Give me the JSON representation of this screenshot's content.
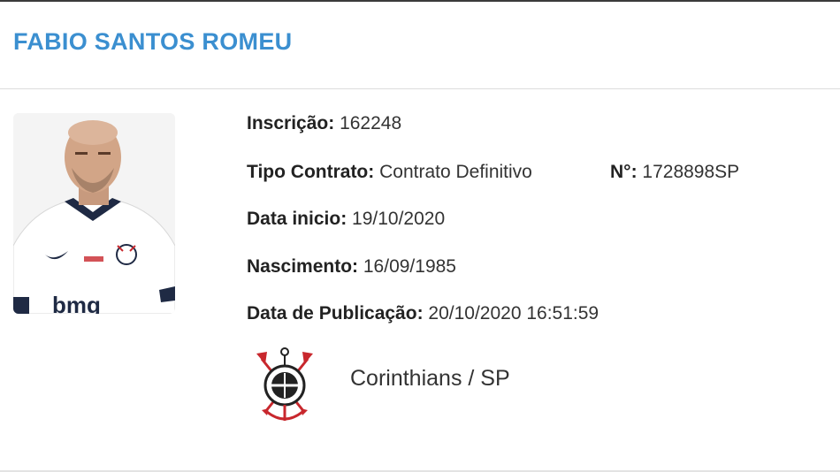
{
  "player": {
    "name": "FABIO SANTOS ROMEU"
  },
  "details": {
    "inscricao": {
      "label": "Inscrição:",
      "value": "162248"
    },
    "tipo_contrato": {
      "label": "Tipo Contrato:",
      "value": "Contrato Definitivo"
    },
    "numero": {
      "label": "N°:",
      "value": "1728898SP"
    },
    "data_inicio": {
      "label": "Data inicio:",
      "value": "19/10/2020"
    },
    "nascimento": {
      "label": "Nascimento:",
      "value": "16/09/1985"
    },
    "publicacao": {
      "label": "Data de Publicação:",
      "value": "20/10/2020 16:51:59"
    }
  },
  "club": {
    "name": "Corinthians / SP",
    "crest_icon": "corinthians-crest-icon"
  },
  "photo": {
    "sponsor": "bmg"
  },
  "colors": {
    "name_blue": "#3b8fd0",
    "crest_red": "#c8272d"
  }
}
